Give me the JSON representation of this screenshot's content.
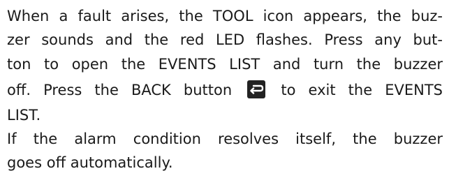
{
  "paragraph1": {
    "line1": "When a fault arises, the TOOL icon appears, the buz-",
    "line2": "zer sounds and the red LED flashes. Press any but-",
    "line3": "ton to open the EVENTS LIST and turn the buzzer",
    "line4_before_icon": "off. Press the BACK button",
    "line4_after_icon": "to exit the EVENTS",
    "line5": "LIST."
  },
  "paragraph2": {
    "line1": "If the alarm condition resolves itself, the buzzer",
    "line2": "goes off automatically."
  },
  "icons": {
    "back_button_icon": "back-arrow-icon",
    "back_icon_color": "#222222"
  }
}
